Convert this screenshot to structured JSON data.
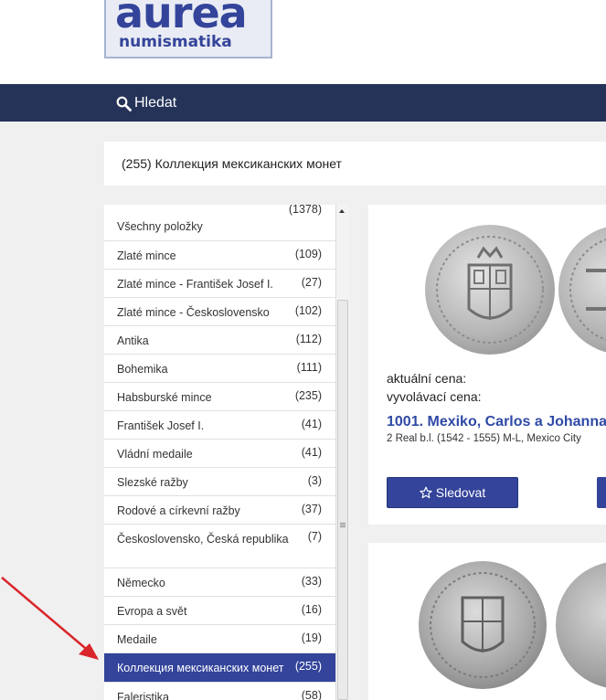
{
  "logo": {
    "line1": "aurea",
    "line2": "numismatika"
  },
  "nav": {
    "search_label": "Hledat"
  },
  "header": {
    "title": "(255) Коллекция мексиканских монет"
  },
  "categories": [
    {
      "label": "Všechny položky",
      "count": "(1378)"
    },
    {
      "label": "Zlaté mince",
      "count": "(109)"
    },
    {
      "label": "Zlaté mince - František Josef I.",
      "count": "(27)"
    },
    {
      "label": "Zlaté mince - Československo",
      "count": "(102)"
    },
    {
      "label": "Antika",
      "count": "(112)"
    },
    {
      "label": "Bohemika",
      "count": "(111)"
    },
    {
      "label": "Habsburské mince",
      "count": "(235)"
    },
    {
      "label": "František Josef I.",
      "count": "(41)"
    },
    {
      "label": "Vládní medaile",
      "count": "(41)"
    },
    {
      "label": "Slezské ražby",
      "count": "(3)"
    },
    {
      "label": "Rodové a církevní ražby",
      "count": "(37)"
    },
    {
      "label": "Československo, Česká republika",
      "count": "(7)"
    },
    {
      "label": "Německo",
      "count": "(33)"
    },
    {
      "label": "Evropa a svět",
      "count": "(16)"
    },
    {
      "label": "Medaile",
      "count": "(19)"
    },
    {
      "label": "Коллекция мексиканских монет",
      "count": "(255)",
      "active": true
    },
    {
      "label": "Faleristika",
      "count": "(58)"
    }
  ],
  "lot": {
    "current_price_label": "aktuální cena:",
    "starting_price_label": "vyvolávací cena:",
    "title": "1001. Mexiko, Carlos a Johanna",
    "description": "2 Real b.l. (1542 - 1555) M-L, Mexico City",
    "watch_label": "Sledovat"
  },
  "colors": {
    "nav_bg": "#253359",
    "accent": "#33449a",
    "link": "#2f4aa6",
    "annotation_arrow": "#d9262b"
  },
  "icons": {
    "search": "search-icon",
    "watch": "star-outline-icon",
    "scroll_up": "arrow-up-icon"
  }
}
